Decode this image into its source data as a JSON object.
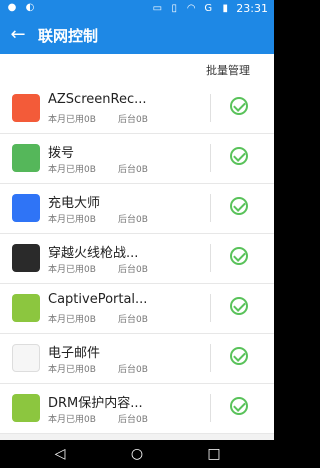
{
  "status": {
    "time": "23:31",
    "left_icons": [
      "notification-dot-icon",
      "water-drop-icon"
    ],
    "right_icons": [
      "cast-icon",
      "vibrate-icon",
      "wifi-icon",
      "g-signal-icon",
      "battery-icon"
    ],
    "g_label": "G"
  },
  "appbar": {
    "title": "联网控制",
    "back_icon": "arrow-left-icon"
  },
  "list_header": {
    "batch_label": "批量管理"
  },
  "items": [
    {
      "name": "AZScreenRec...",
      "month_usage": "本月已用0B",
      "background_usage": "后台0B",
      "icon": "video-icon",
      "color": "#f35b39"
    },
    {
      "name": "拨号",
      "month_usage": "本月已用0B",
      "background_usage": "后台0B",
      "icon": "phone-icon",
      "color": "#55b75a"
    },
    {
      "name": "充电大师",
      "month_usage": "本月已用0B",
      "background_usage": "后台0B",
      "icon": "battery-app-icon",
      "color": "#2f74f6"
    },
    {
      "name": "穿越火线枪战...",
      "month_usage": "本月已用0B",
      "background_usage": "后台0B",
      "icon": "game-icon",
      "color": "#2a2a2a"
    },
    {
      "name": "CaptivePortal...",
      "month_usage": "本月已用0B",
      "background_usage": "后台0B",
      "icon": "android-icon",
      "color": "#8cc63f"
    },
    {
      "name": "电子邮件",
      "month_usage": "本月已用0B",
      "background_usage": "后台0B",
      "icon": "email-icon",
      "color": "#f6f6f6"
    },
    {
      "name": "DRM保护内容...",
      "month_usage": "本月已用0B",
      "background_usage": "后台0B",
      "icon": "android-icon",
      "color": "#8cc63f"
    }
  ],
  "accent_colors": {
    "appbar": "#1e88e5",
    "check": "#59c25a"
  },
  "navbar": {
    "back_icon": "nav-back-icon",
    "home_icon": "nav-home-icon",
    "recent_icon": "nav-recent-icon"
  }
}
